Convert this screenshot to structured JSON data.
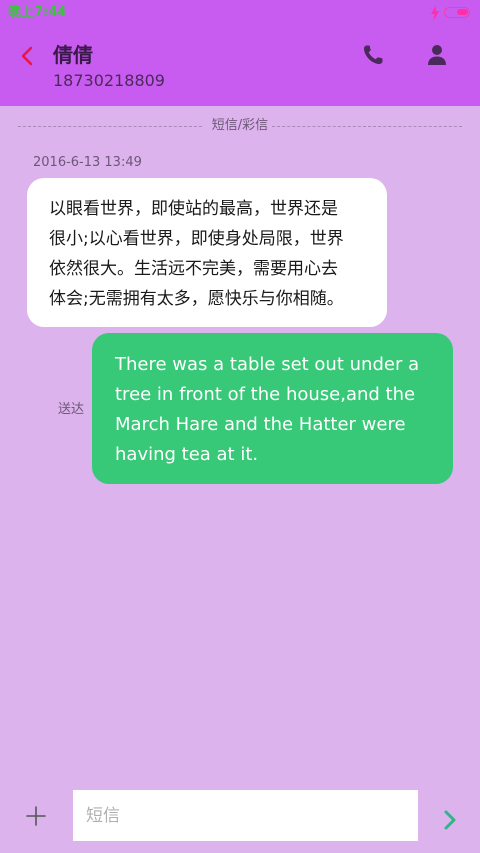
{
  "status_bar": {
    "time": "晚上7:44",
    "charging_icon": "lightning-bolt-icon",
    "battery_icon": "battery-icon",
    "battery_level": 0.55
  },
  "header": {
    "back_icon": "chevron-left-icon",
    "contact_name": "倩倩",
    "contact_number": "18730218809",
    "call_icon": "phone-icon",
    "contact_icon": "person-icon"
  },
  "thread": {
    "channel_label": "短信/彩信",
    "messages": [
      {
        "direction": "incoming",
        "timestamp": "2016-6-13 13:49",
        "lines": [
          "以眼看世界，即使站的最高，世界还是",
          "很小;以心看世界，即使身处局限，世界",
          "依然很大。生活远不完美，需要用心去",
          "体会;无需拥有太多，愿快乐与你相随。"
        ]
      },
      {
        "direction": "outgoing",
        "status": "送达",
        "lines": [
          "There was a table set out under a",
          "tree in front of the house,and the",
          "March Hare and the Hatter were",
          "having tea at it."
        ]
      }
    ]
  },
  "composer": {
    "attach_icon": "plus-icon",
    "placeholder": "短信",
    "value": "",
    "send_icon": "chevron-right-icon"
  },
  "colors": {
    "header_bg": "#c95cf0",
    "page_bg": "#dcb3ec",
    "back_accent": "#e8174a",
    "outgoing_bubble": "#37c878",
    "send_accent": "#2fb58a",
    "time_color": "#37c63a",
    "battery_color": "#ff2fa6"
  }
}
